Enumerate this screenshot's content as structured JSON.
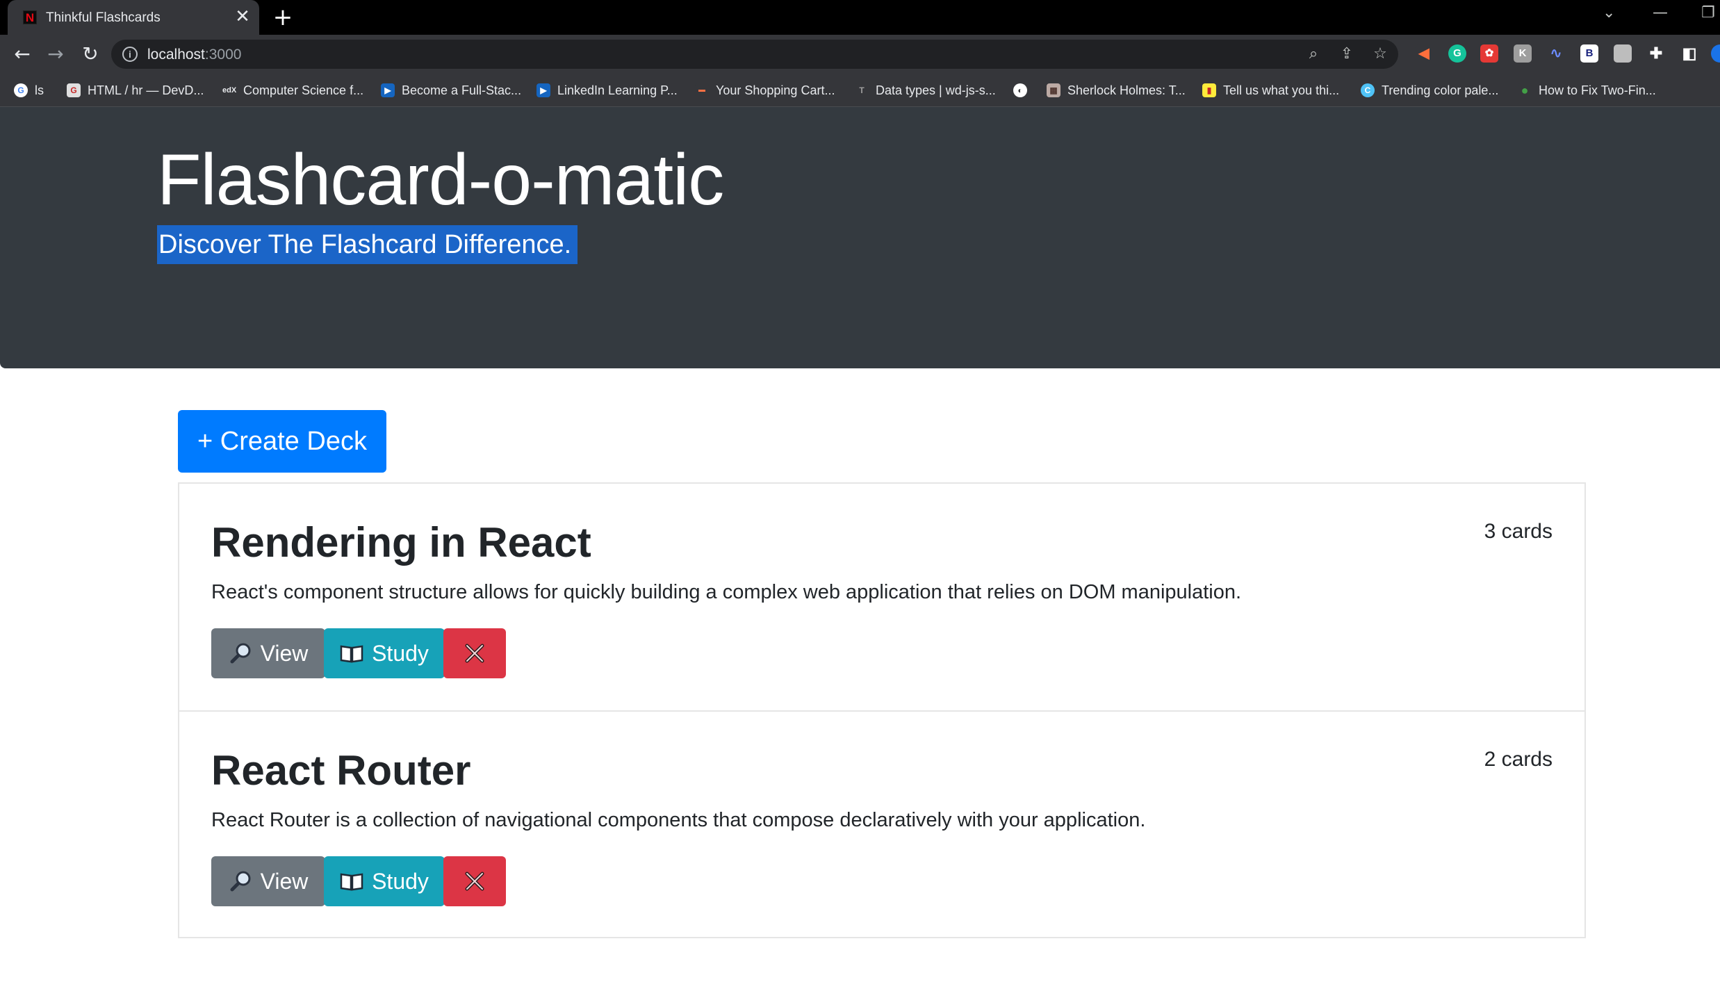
{
  "browser": {
    "tab_title": "Thinkful Flashcards",
    "tab_close": "✕",
    "new_tab": "+",
    "url_host": "localhost",
    "url_port": ":3000",
    "bookmarks": [
      {
        "label": "ls",
        "icon": "google-icon"
      },
      {
        "label": "HTML / hr — DevD...",
        "icon": "devdocs-icon"
      },
      {
        "label": "Computer Science f...",
        "icon": "edx-icon"
      },
      {
        "label": "Become a Full-Stac...",
        "icon": "video-icon"
      },
      {
        "label": "LinkedIn Learning P...",
        "icon": "video-icon"
      },
      {
        "label": "Your Shopping Cart...",
        "icon": "cart-icon"
      },
      {
        "label": "Data types | wd-js-s...",
        "icon": "doc-icon"
      },
      {
        "label": "",
        "icon": "globe-icon"
      },
      {
        "label": "Sherlock Holmes: T...",
        "icon": "book-icon"
      },
      {
        "label": "Tell us what you thi...",
        "icon": "survey-icon"
      },
      {
        "label": "Trending color pale...",
        "icon": "palette-icon"
      },
      {
        "label": "How to Fix Two-Fin...",
        "icon": "person-icon"
      }
    ]
  },
  "header": {
    "title": "Flashcard-o-matic",
    "lead": "Discover The Flashcard Difference."
  },
  "create_button": "+ Create Deck",
  "decks": [
    {
      "title": "Rendering in React",
      "count": "3 cards",
      "description": "React's component structure allows for quickly building a complex web application that relies on DOM manipulation.",
      "view_label": "View",
      "study_label": "Study"
    },
    {
      "title": "React Router",
      "count": "2 cards",
      "description": "React Router is a collection of navigational components that compose declaratively with your application.",
      "view_label": "View",
      "study_label": "Study"
    }
  ],
  "colors": {
    "jumbotron": "#343a40",
    "primary": "#007bff",
    "secondary": "#6c757d",
    "info": "#17a2b8",
    "danger": "#dc3545"
  }
}
